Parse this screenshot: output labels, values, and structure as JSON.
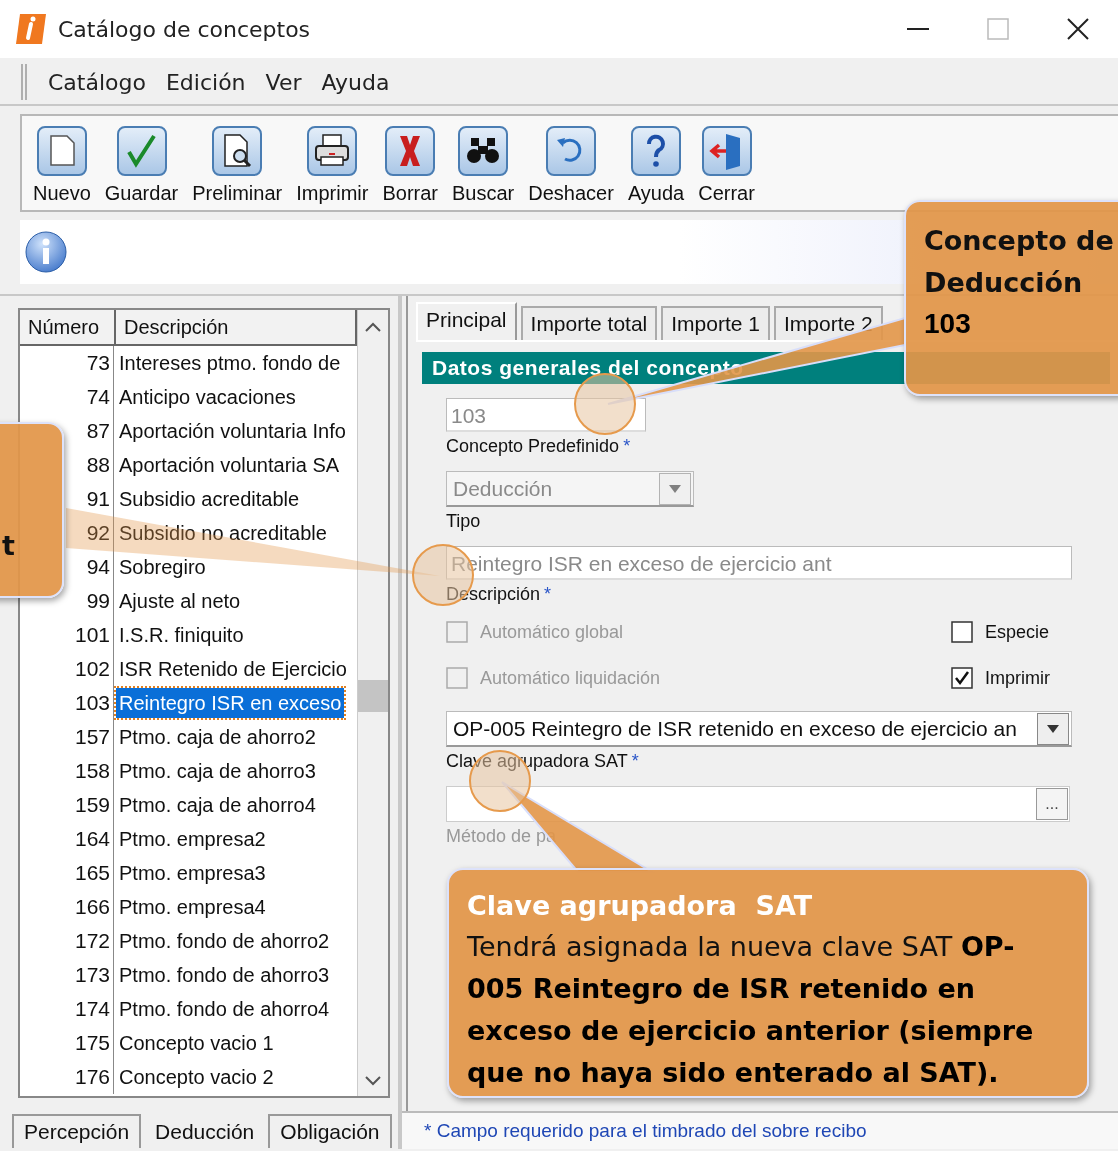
{
  "window": {
    "title": "Catálogo de conceptos"
  },
  "menu": [
    "Catálogo",
    "Edición",
    "Ver",
    "Ayuda"
  ],
  "toolbar": [
    "Nuevo",
    "Guardar",
    "Preliminar",
    "Imprimir",
    "Borrar",
    "Buscar",
    "Deshacer",
    "Ayuda",
    "Cerrar"
  ],
  "concept_list": {
    "columns": [
      "Número",
      "Descripción"
    ],
    "rows": [
      {
        "number": "73",
        "description": "Intereses ptmo. fondo de",
        "selected": false
      },
      {
        "number": "74",
        "description": "Anticipo vacaciones",
        "selected": false
      },
      {
        "number": "87",
        "description": "Aportación voluntaria Info",
        "selected": false
      },
      {
        "number": "88",
        "description": "Aportación voluntaria SA",
        "selected": false
      },
      {
        "number": "91",
        "description": "Subsidio acreditable",
        "selected": false
      },
      {
        "number": "92",
        "description": "Subsidio no acreditable",
        "selected": false
      },
      {
        "number": "94",
        "description": "Sobregiro",
        "selected": false
      },
      {
        "number": "99",
        "description": "Ajuste al neto",
        "selected": false
      },
      {
        "number": "101",
        "description": "I.S.R. finiquito",
        "selected": false
      },
      {
        "number": "102",
        "description": "ISR Retenido de Ejercicio",
        "selected": false
      },
      {
        "number": "103",
        "description": "Reintegro ISR en exceso",
        "selected": true
      },
      {
        "number": "157",
        "description": "Ptmo. caja de ahorro2",
        "selected": false
      },
      {
        "number": "158",
        "description": "Ptmo. caja de ahorro3",
        "selected": false
      },
      {
        "number": "159",
        "description": "Ptmo. caja de ahorro4",
        "selected": false
      },
      {
        "number": "164",
        "description": "Ptmo. empresa2",
        "selected": false
      },
      {
        "number": "165",
        "description": "Ptmo. empresa3",
        "selected": false
      },
      {
        "number": "166",
        "description": "Ptmo. empresa4",
        "selected": false
      },
      {
        "number": "172",
        "description": "Ptmo. fondo de ahorro2",
        "selected": false
      },
      {
        "number": "173",
        "description": "Ptmo. fondo de ahorro3",
        "selected": false
      },
      {
        "number": "174",
        "description": "Ptmo. fondo de ahorro4",
        "selected": false
      },
      {
        "number": "175",
        "description": "Concepto vacio 1",
        "selected": false
      },
      {
        "number": "176",
        "description": "Concepto vacio 2",
        "selected": false
      }
    ]
  },
  "list_tabs": [
    {
      "label": "Percepción",
      "selected": false
    },
    {
      "label": "Deducción",
      "selected": true
    },
    {
      "label": "Obligación",
      "selected": false
    }
  ],
  "detail_tabs": [
    {
      "label": "Principal",
      "selected": true
    },
    {
      "label": "Importe total",
      "selected": false
    },
    {
      "label": "Importe 1",
      "selected": false
    },
    {
      "label": "Importe 2",
      "selected": false
    }
  ],
  "section_title": "Datos generales del concepto",
  "form": [
    {
      "kind": "number",
      "value": "103",
      "disabled": true,
      "label": "Concepto Predefinido",
      "required_mark": "*"
    },
    {
      "kind": "select",
      "value": "Deducción",
      "disabled": true,
      "label": "Tipo"
    },
    {
      "kind": "text",
      "value": "Reintegro ISR en exceso de ejercicio ant",
      "disabled": true,
      "label": "Descripción",
      "required_mark": "*"
    },
    {
      "kind": "checkboxes",
      "items": [
        {
          "label": "Automático global",
          "checked": false,
          "disabled": true
        },
        {
          "label": "Especie",
          "checked": false,
          "disabled": false
        },
        {
          "label": "Automático liquidación",
          "checked": false,
          "disabled": true
        },
        {
          "label": "Imprimir",
          "checked": true,
          "disabled": false
        }
      ]
    },
    {
      "kind": "wide_select",
      "value": "OP-005 Reintegro de ISR retenido en exceso de ejercicio an",
      "disabled": false,
      "label": "Clave agrupadora SAT",
      "required_mark": "*"
    },
    {
      "kind": "browse",
      "button": "...",
      "disabled": true,
      "label": "Método de pa"
    }
  ],
  "footer": "* Campo requerido para el timbrado del sobre recibo",
  "callouts": [
    {
      "kind": "corner",
      "title": "Concepto de Deducción",
      "value": "103"
    },
    {
      "kind": "edge",
      "title": "t"
    },
    {
      "kind": "note",
      "title": "Clave agrupadora  SAT",
      "body": "Tendrá asignada la nueva clave SAT  **OP-005 Reintegro de ISR retenido en exceso de ejercicio anterior (siempre que no haya sido enterado al SAT).**"
    }
  ]
}
